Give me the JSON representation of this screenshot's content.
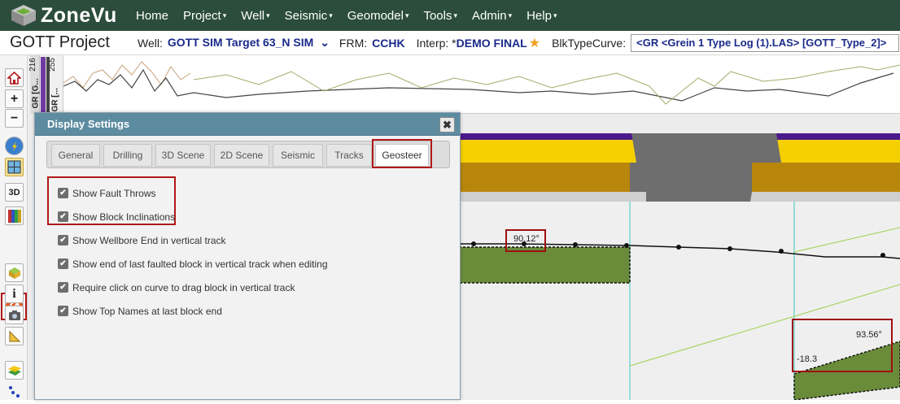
{
  "nav": {
    "logo_text": "ZoneVu",
    "items": [
      {
        "label": "Home",
        "has_caret": false
      },
      {
        "label": "Project",
        "has_caret": true
      },
      {
        "label": "Well",
        "has_caret": true
      },
      {
        "label": "Seismic",
        "has_caret": true
      },
      {
        "label": "Geomodel",
        "has_caret": true
      },
      {
        "label": "Tools",
        "has_caret": true
      },
      {
        "label": "Admin",
        "has_caret": true
      },
      {
        "label": "Help",
        "has_caret": true
      }
    ],
    "caret": "▾"
  },
  "infobar": {
    "project_title": "GOTT Project",
    "well_label": "Well:",
    "well_value": "GOTT SIM Target 63_N SIM",
    "well_caret": "⌄",
    "frm_label": "FRM:",
    "frm_value": "CCHK",
    "interp_label": "Interp: *",
    "interp_value": "DEMO FINAL",
    "blk_label": "BlkTypeCurve:",
    "blk_value": "<GR <Grein 1 Type Log (1).LAS> [GOTT_Type_2]>"
  },
  "log_track": {
    "label_1": "GR [G...",
    "label_2": "GR [...",
    "value_top": "216",
    "value_alt": "255"
  },
  "dialog": {
    "title": "Display Settings",
    "close_label": "✖",
    "tabs": [
      "General",
      "Drilling",
      "3D Scene",
      "2D Scene",
      "Seismic",
      "Tracks",
      "Geosteer"
    ],
    "active_tab": "Geosteer",
    "options": [
      {
        "label": "Show Fault Throws",
        "checked": true
      },
      {
        "label": "Show Block Inclinations",
        "checked": true
      },
      {
        "label": "Show Wellbore End in vertical track",
        "checked": true
      },
      {
        "label": "Show end of last faulted block in vertical track when editing",
        "checked": true
      },
      {
        "label": "Require click on curve to drag block in vertical track",
        "checked": true
      },
      {
        "label": "Show Top Names at last block end",
        "checked": true
      }
    ],
    "check_glyph": "✔"
  },
  "annotations": {
    "inclination_1": "90.12°",
    "inclination_2": "93.56°",
    "fault_throw": "-18.3"
  },
  "colors": {
    "nav_bg": "#2c4d3c",
    "dialog_header": "#5d8ca1",
    "highlight": "#b01818",
    "block_green": "#6a8c3a",
    "layer_purple": "#4b1a8c",
    "layer_yellow": "#f5d000",
    "layer_gold": "#b8860b",
    "fault_gray": "#6e6e6e"
  }
}
